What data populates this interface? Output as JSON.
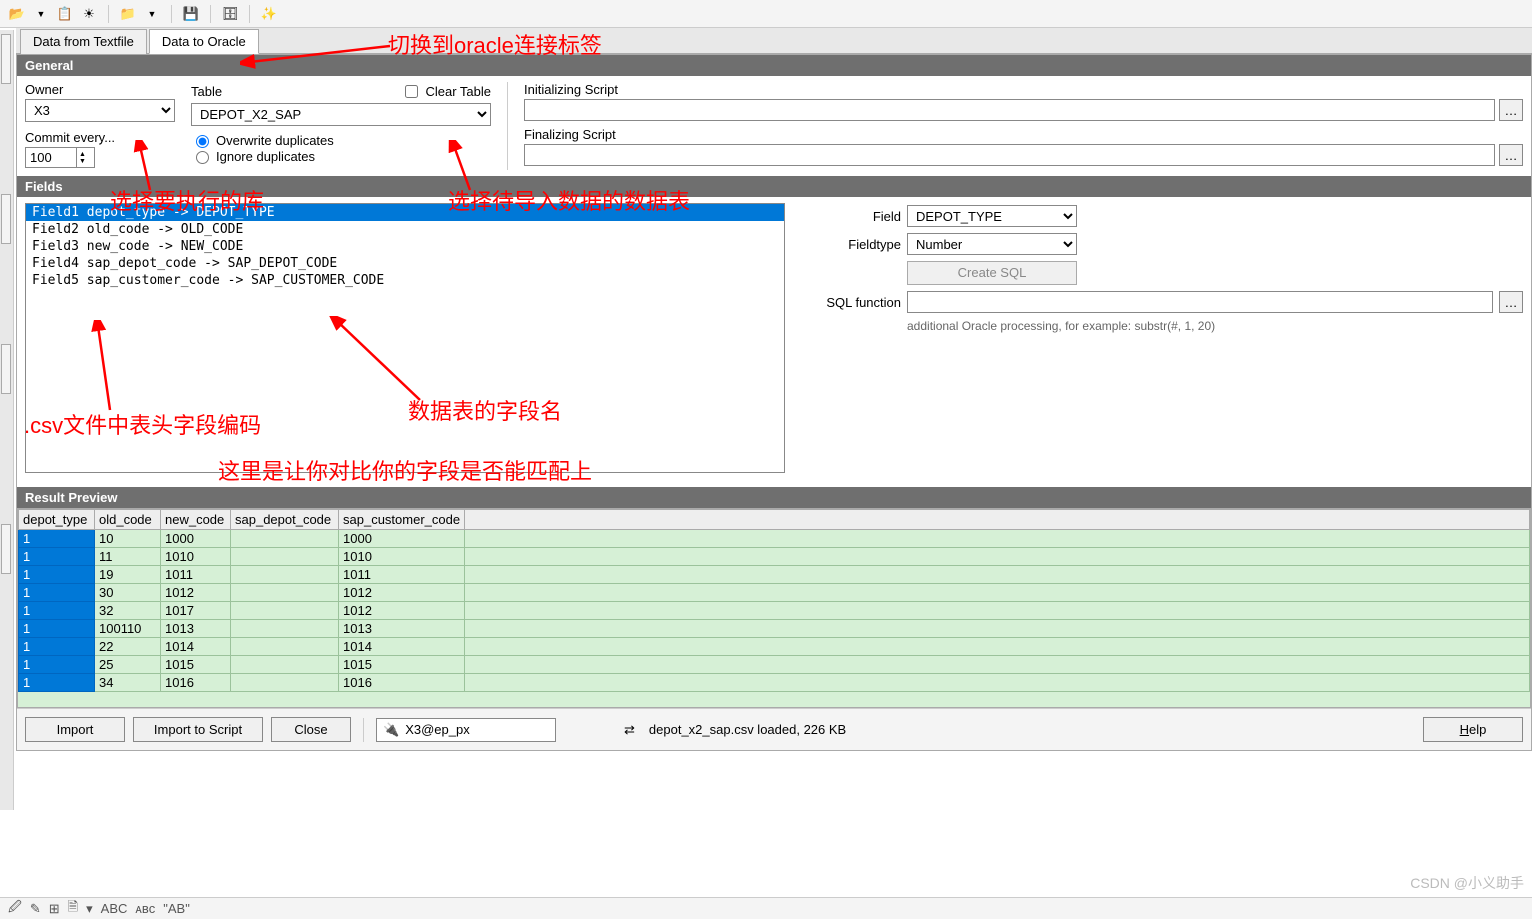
{
  "toolbar_icons": [
    "open-file-icon",
    "chevron-down-icon",
    "copy-icon",
    "sun-icon",
    "folder-open-icon",
    "chevron-down-icon",
    "save-icon",
    "db-icon",
    "wand-icon"
  ],
  "tabs": [
    {
      "label": "Data from Textfile",
      "active": false
    },
    {
      "label": "Data to Oracle",
      "active": true
    }
  ],
  "sections": {
    "general": "General",
    "fields": "Fields",
    "result_preview": "Result Preview"
  },
  "general": {
    "owner_label": "Owner",
    "owner_value": "X3",
    "table_label": "Table",
    "table_value": "DEPOT_X2_SAP",
    "clear_table_label": "Clear Table",
    "clear_table_checked": false,
    "commit_every_label": "Commit every...",
    "commit_every_value": "100",
    "overwrite_label": "Overwrite duplicates",
    "ignore_label": "Ignore duplicates",
    "dup_mode": "overwrite",
    "init_script_label": "Initializing Script",
    "init_script_value": "",
    "final_script_label": "Finalizing Script",
    "final_script_value": ""
  },
  "fields": {
    "list": [
      {
        "text": "Field1  depot_type  ->  DEPOT_TYPE",
        "selected": true
      },
      {
        "text": "Field2  old_code  ->  OLD_CODE",
        "selected": false
      },
      {
        "text": "Field3  new_code  ->  NEW_CODE",
        "selected": false
      },
      {
        "text": "Field4  sap_depot_code  ->  SAP_DEPOT_CODE",
        "selected": false
      },
      {
        "text": "Field5  sap_customer_code  ->  SAP_CUSTOMER_CODE",
        "selected": false
      }
    ],
    "field_label": "Field",
    "field_value": "DEPOT_TYPE",
    "fieldtype_label": "Fieldtype",
    "fieldtype_value": "Number",
    "create_sql_label": "Create SQL",
    "sql_function_label": "SQL function",
    "sql_function_value": "",
    "hint": "additional Oracle processing, for example: substr(#, 1, 20)"
  },
  "preview": {
    "columns": [
      "depot_type",
      "old_code",
      "new_code",
      "sap_depot_code",
      "sap_customer_code"
    ],
    "rows": [
      [
        "1",
        "10",
        "1000",
        "",
        "1000"
      ],
      [
        "1",
        "11",
        "1010",
        "",
        "1010"
      ],
      [
        "1",
        "19",
        "1011",
        "",
        "1011"
      ],
      [
        "1",
        "30",
        "1012",
        "",
        "1012"
      ],
      [
        "1",
        "32",
        "1017",
        "",
        "1012"
      ],
      [
        "1",
        "100110",
        "1013",
        "",
        "1013"
      ],
      [
        "1",
        "22",
        "1014",
        "",
        "1014"
      ],
      [
        "1",
        "25",
        "1015",
        "",
        "1015"
      ],
      [
        "1",
        "34",
        "1016",
        "",
        "1016"
      ]
    ]
  },
  "bottom": {
    "import": "Import",
    "import_to_script": "Import to Script",
    "close": "Close",
    "connection": "X3@ep_px",
    "status": "depot_x2_sap.csv loaded,  226 KB",
    "help": "Help"
  },
  "annotations": {
    "a1": "切换到oracle连接标签",
    "a2": "选择要执行的库",
    "a3": "选择待导入数据的数据表",
    "a4": ".csv文件中表头字段编码",
    "a5": "数据表的字段名",
    "a6": "这里是让你对比你的字段是否能匹配上"
  },
  "watermark": "CSDN @小义助手",
  "footer_glyphs": [
    "🖉",
    "✎",
    "⊞",
    "🗎",
    "▾",
    "ABC",
    "ᴀʙᴄ",
    "\"AB\""
  ]
}
